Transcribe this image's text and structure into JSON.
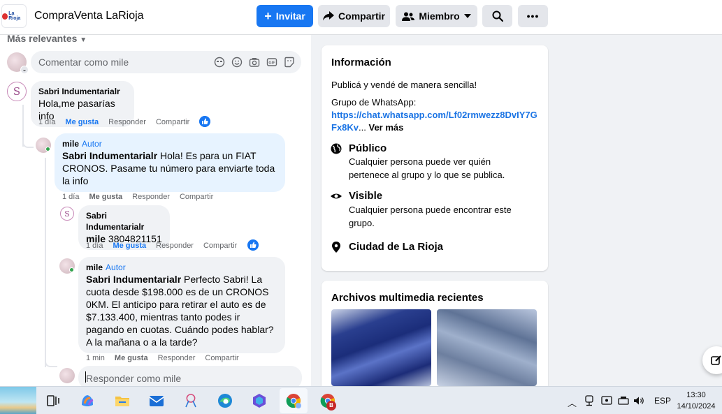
{
  "header": {
    "group_name": "CompraVenta LaRioja",
    "logo_text": "La Rioja",
    "invite_label": "Invitar",
    "share_label": "Compartir",
    "member_label": "Miembro"
  },
  "comments": {
    "sort_label": "Más relevantes",
    "input_placeholder": "Comentar como mile",
    "reply_placeholder": "Responder como mile",
    "items": [
      {
        "name": "Sabri Indumentarialr",
        "text": "Hola,me pasarías info",
        "age": "1 día",
        "like": "Me gusta",
        "reply": "Responder",
        "share": "Compartir",
        "avatar_letter": "S"
      },
      {
        "name": "mile",
        "role": "Autor",
        "mention": "Sabri Indumentarialr",
        "text": " Hola! Es para un FIAT CRONOS. Pasame tu número para enviarte toda la info",
        "age": "1 día",
        "like": "Me gusta",
        "reply": "Responder",
        "share": "Compartir"
      },
      {
        "name": "Sabri Indumentarialr",
        "mention": "mile",
        "text": " 3804821151",
        "age": "1 día",
        "like": "Me gusta",
        "reply": "Responder",
        "share": "Compartir",
        "avatar_letter": "S"
      },
      {
        "name": "mile",
        "role": "Autor",
        "mention": "Sabri Indumentarialr",
        "text": " Perfecto Sabri! La cuota desde $198.000 es de un CRONOS 0KM. El anticipo para retirar el auto es de $7.133.400, mientras tanto podes ir pagando en cuotas. Cuándo podes hablar? A la mañana o a la tarde?",
        "age": "1 min",
        "like": "Me gusta",
        "reply": "Responder",
        "share": "Compartir"
      }
    ]
  },
  "info_card": {
    "title": "Información",
    "description": "Publicá y vendé de manera sencilla!",
    "whatsapp_label": "Grupo de WhatsApp:",
    "whatsapp_link_1": "https://chat.whatsapp.com/Lf02rmwezz8DvIY7G",
    "whatsapp_link_2": "Fx8Kv",
    "ellipsis": "...",
    "see_more": "Ver más",
    "public_title": "Público",
    "public_desc": "Cualquier persona puede ver quién pertenece al grupo y lo que se publica.",
    "visible_title": "Visible",
    "visible_desc": "Cualquier persona puede encontrar este grupo.",
    "location": "Ciudad de La Rioja"
  },
  "media_card": {
    "title": "Archivos multimedia recientes"
  },
  "taskbar": {
    "language": "ESP",
    "time": "13:30",
    "date": "14/10/2024",
    "notif_badge": "B"
  },
  "colors": {
    "accent": "#1877f2",
    "link": "#1b74e4",
    "page_bg": "#f0f2f5",
    "author_bubble": "#e7f3ff"
  }
}
